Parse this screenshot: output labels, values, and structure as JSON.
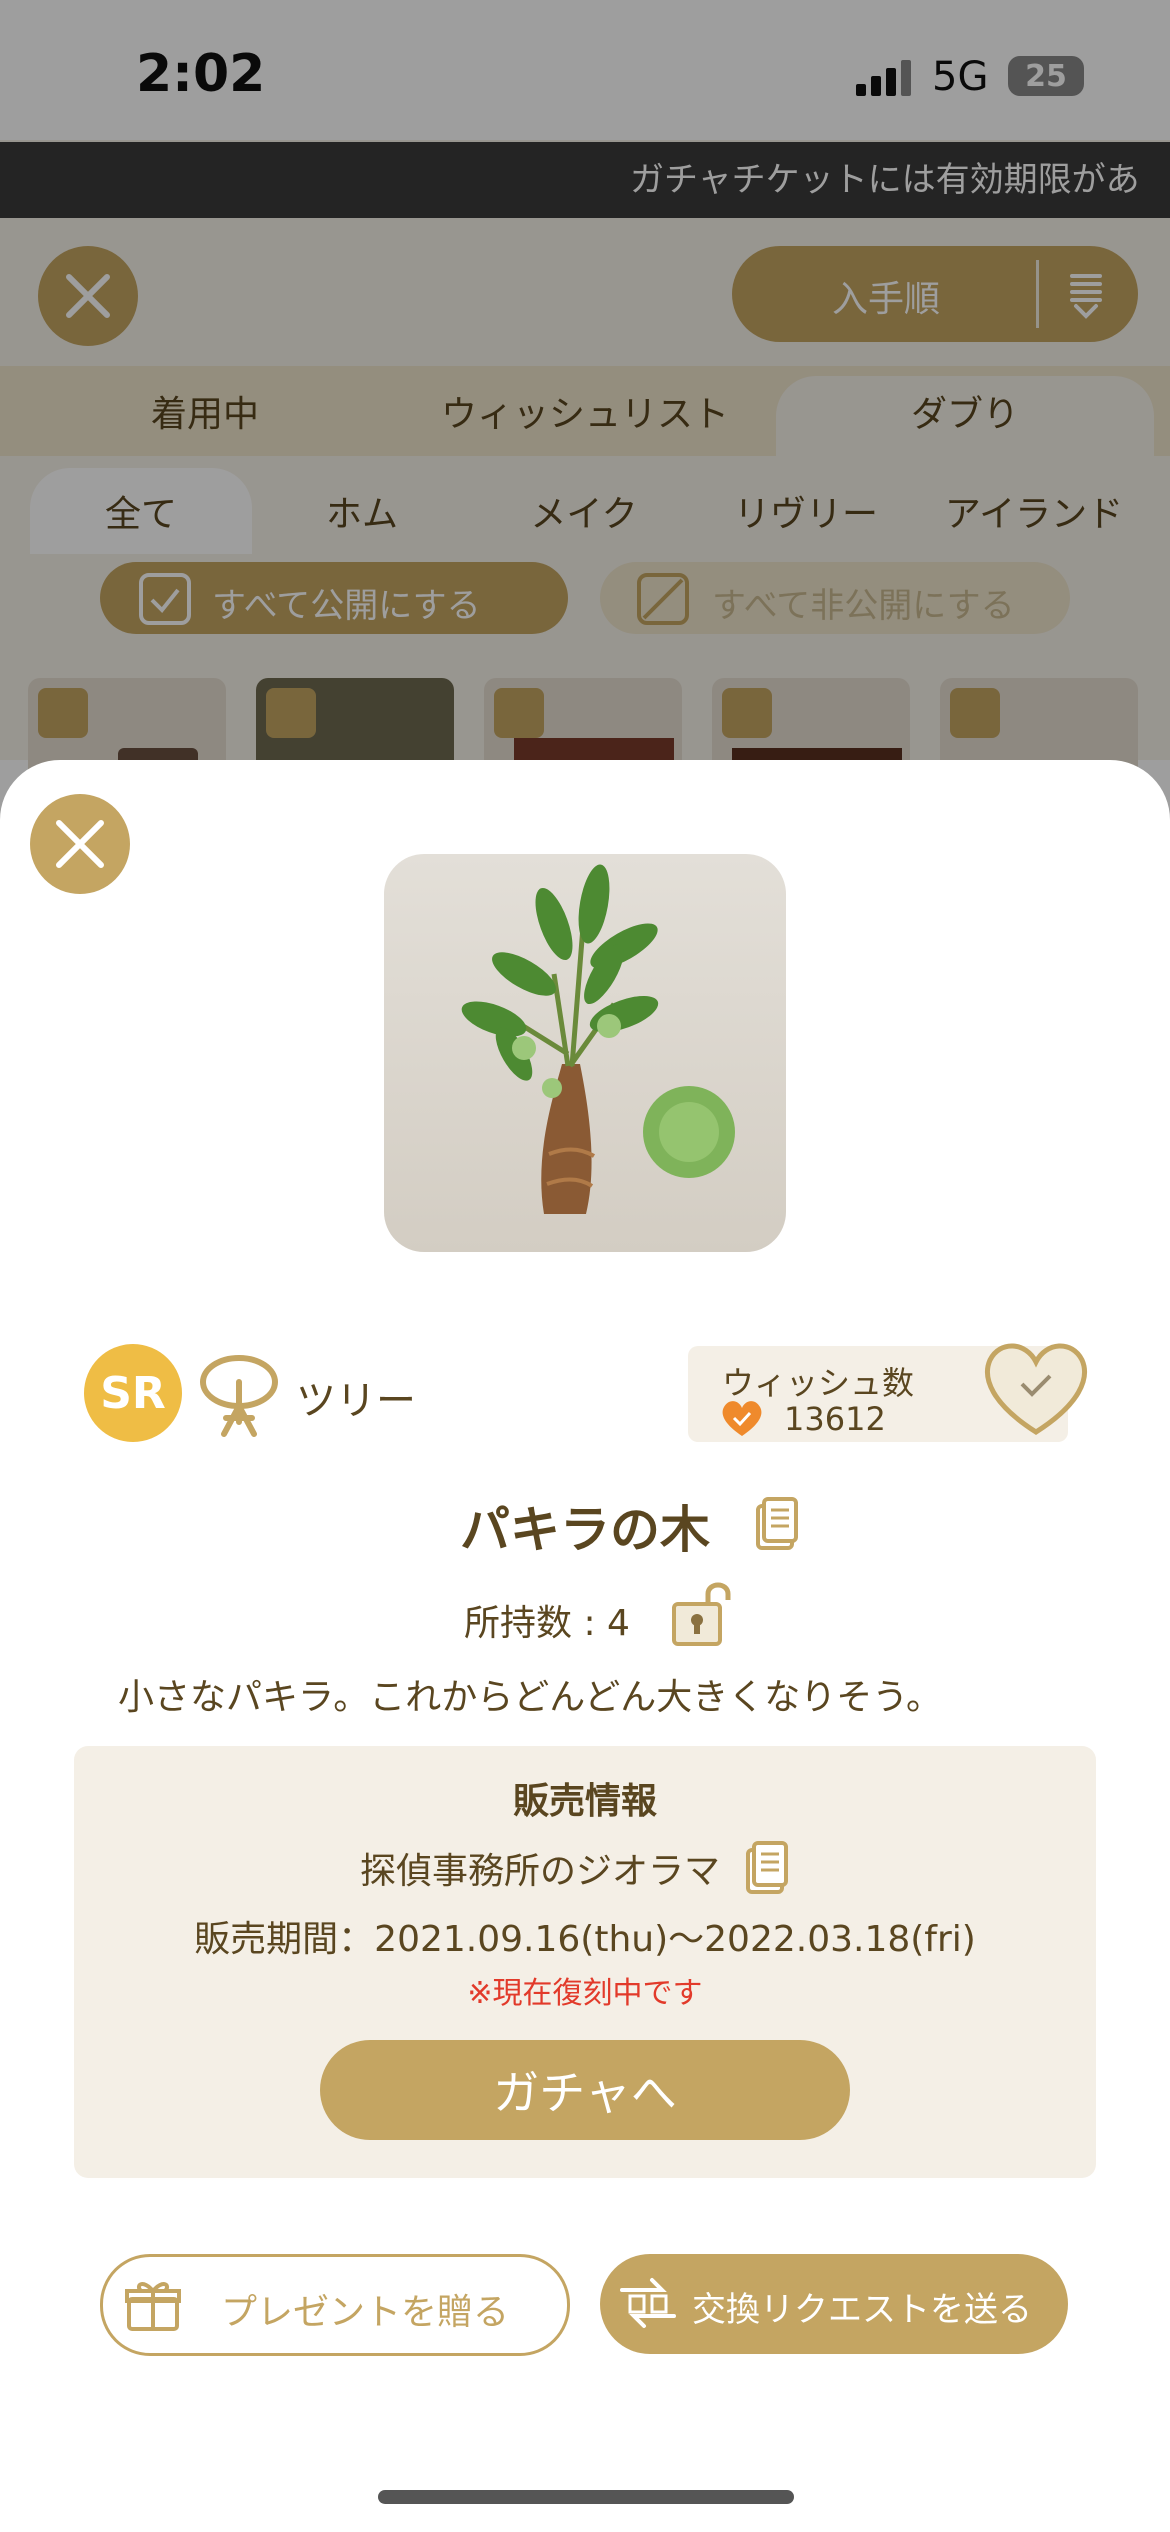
{
  "status": {
    "time": "2:02",
    "network": "5G",
    "battery": "25"
  },
  "ticker_text": "ガチャチケットには有効期限があ",
  "header": {
    "sort_label": "入手順"
  },
  "tabs": [
    "着用中",
    "ウィッシュリスト",
    "ダブり"
  ],
  "subtabs": [
    "全て",
    "ホム",
    "メイク",
    "リヴリー",
    "アイランド"
  ],
  "public_actions": {
    "publish_all": "すべて公開にする",
    "unpublish_all": "すべて非公開にする"
  },
  "item": {
    "rarity": "SR",
    "category": "ツリー",
    "wish_label": "ウィッシュ数",
    "wish_count": "13612",
    "name": "パキラの木",
    "owned": "所持数 : 4",
    "description": "小さなパキラ。これからどんどん大きくなりそう。"
  },
  "sales": {
    "title": "販売情報",
    "source": "探偵事務所のジオラマ",
    "period": "販売期間：2021.09.16(thu)〜2022.03.18(fri)",
    "notice": "※現在復刻中です",
    "gacha_button": "ガチャへ"
  },
  "actions": {
    "present": "プレゼントを贈る",
    "exchange": "交換リクエストを送る"
  },
  "colors": {
    "accent": "#c4a562",
    "text": "#5a4620",
    "notice": "#e23a2a",
    "card": "#f4efe6"
  }
}
